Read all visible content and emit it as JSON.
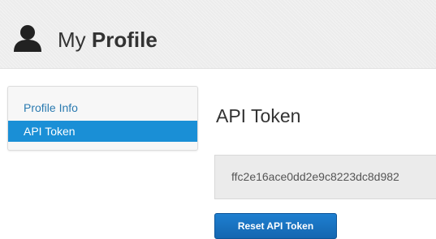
{
  "header": {
    "icon": "user-icon",
    "title_prefix": "My",
    "title_strong": "Profile"
  },
  "sidebar": {
    "items": [
      {
        "label": "Profile Info",
        "active": false
      },
      {
        "label": "API Token",
        "active": true
      }
    ]
  },
  "main": {
    "section_title": "API Token",
    "token_value": "ffc2e16ace0dd2e9c8223dc8d982",
    "reset_button_label": "Reset API Token"
  },
  "colors": {
    "accent": "#1a8fd6",
    "link": "#2a7ab0",
    "button": "#1466b0"
  }
}
